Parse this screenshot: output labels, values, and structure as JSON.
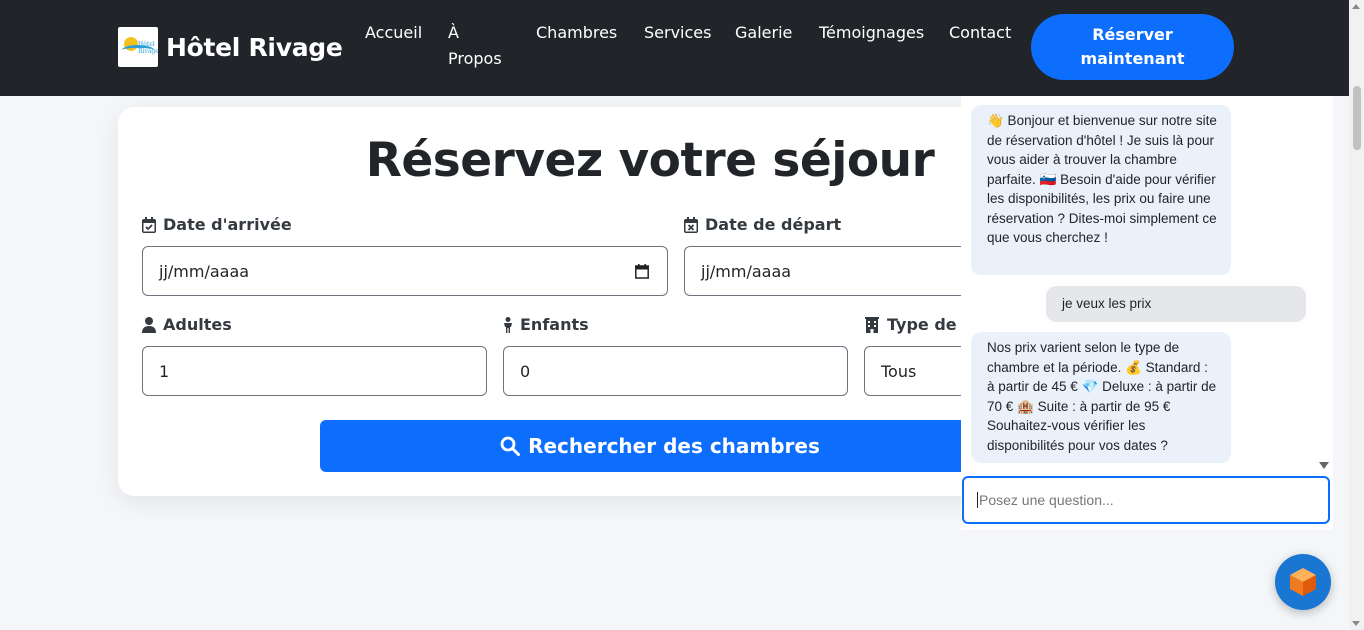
{
  "header": {
    "brand": "Hôtel Rivage",
    "logo_text": "Hôtel Rivage",
    "nav": [
      "Accueil",
      "À\nPropos",
      "Chambres",
      "Services",
      "Galerie",
      "Témoignages",
      "Contact"
    ],
    "cta": "Réserver maintenant"
  },
  "booking": {
    "title": "Réservez votre séjour",
    "arrival_label": "Date d'arrivée",
    "arrival_value": "jj/mm/aaaa",
    "departure_label": "Date de départ",
    "departure_value": "jj/mm/aaaa",
    "adults_label": "Adultes",
    "adults_value": "1",
    "children_label": "Enfants",
    "children_value": "0",
    "room_type_label": "Type de c",
    "room_type_value": "Tous",
    "search_button": "Rechercher des chambres"
  },
  "chat": {
    "messages": [
      {
        "from": "bot",
        "text": "👋 Bonjour et bienvenue sur notre site de réservation d'hôtel ! Je suis là pour vous aider à trouver la chambre parfaite. 🇸🇮 Besoin d'aide pour vérifier les disponibilités, les prix ou faire une réservation ? Dites-moi simplement ce que vous cherchez !"
      },
      {
        "from": "user",
        "text": "je veux les prix"
      },
      {
        "from": "bot",
        "text": "Nos prix varient selon le type de chambre et la période. 💰 Standard : à partir de 45 € 💎 Deluxe : à partir de 70 € 🏨 Suite : à partir de 95 € Souhaitez-vous vérifier les disponibilités pour vos dates ?"
      }
    ],
    "input_placeholder": "Posez une question..."
  },
  "colors": {
    "navbar": "#212529",
    "primary": "#0d6efd",
    "bot_bubble": "#eaf1fb",
    "user_bubble": "#e5e7ea"
  },
  "icons": [
    "calendar-check-icon",
    "calendar-x-icon",
    "user-icon",
    "child-icon",
    "building-icon",
    "search-icon",
    "chat-cube-icon"
  ]
}
